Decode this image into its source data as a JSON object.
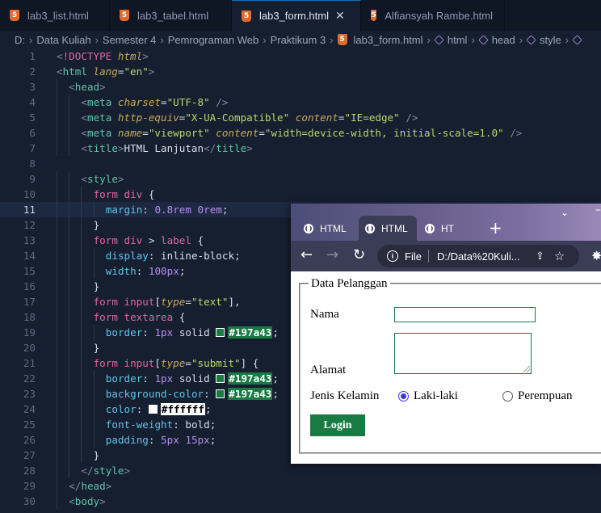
{
  "editor": {
    "tabs": [
      {
        "label": "lab3_list.html",
        "active": false
      },
      {
        "label": "lab3_tabel.html",
        "active": false
      },
      {
        "label": "lab3_form.html",
        "active": true
      },
      {
        "label": "Alfiansyah Rambe.html",
        "active": false
      }
    ],
    "breadcrumb": [
      "D:",
      "Data Kuliah",
      "Semester 4",
      "Pemrograman Web",
      "Praktikum 3",
      "lab3_form.html",
      "html",
      "head",
      "style"
    ],
    "current_line": 11,
    "lines": [
      {
        "n": "1",
        "indent": 0,
        "parts": [
          [
            "t-pu",
            "<"
          ],
          [
            "t-doc",
            "!DOCTYPE "
          ],
          [
            "t-att",
            "html"
          ],
          [
            "t-pu",
            ">"
          ]
        ]
      },
      {
        "n": "2",
        "indent": 0,
        "parts": [
          [
            "t-pu",
            "<"
          ],
          [
            "t-tag",
            "html "
          ],
          [
            "t-att",
            "lang"
          ],
          [
            "t-txt",
            "="
          ],
          [
            "t-str",
            "\"en\""
          ],
          [
            "t-pu",
            ">"
          ]
        ]
      },
      {
        "n": "3",
        "indent": 1,
        "parts": [
          [
            "t-pu",
            "<"
          ],
          [
            "t-tag",
            "head"
          ],
          [
            "t-pu",
            ">"
          ]
        ]
      },
      {
        "n": "4",
        "indent": 2,
        "parts": [
          [
            "t-pu",
            "<"
          ],
          [
            "t-tag",
            "meta "
          ],
          [
            "t-att",
            "charset"
          ],
          [
            "t-txt",
            "="
          ],
          [
            "t-str",
            "\"UTF-8\""
          ],
          [
            "t-pu",
            " />"
          ]
        ]
      },
      {
        "n": "5",
        "indent": 2,
        "parts": [
          [
            "t-pu",
            "<"
          ],
          [
            "t-tag",
            "meta "
          ],
          [
            "t-att",
            "http-equiv"
          ],
          [
            "t-txt",
            "="
          ],
          [
            "t-str",
            "\"X-UA-Compatible\" "
          ],
          [
            "t-att",
            "content"
          ],
          [
            "t-txt",
            "="
          ],
          [
            "t-str",
            "\"IE=edge\""
          ],
          [
            "t-pu",
            " />"
          ]
        ]
      },
      {
        "n": "6",
        "indent": 2,
        "parts": [
          [
            "t-pu",
            "<"
          ],
          [
            "t-tag",
            "meta "
          ],
          [
            "t-att",
            "name"
          ],
          [
            "t-txt",
            "="
          ],
          [
            "t-str",
            "\"viewport\" "
          ],
          [
            "t-att",
            "content"
          ],
          [
            "t-txt",
            "="
          ],
          [
            "t-str",
            "\"width=device-width, initial-scale=1.0\""
          ],
          [
            "t-pu",
            " />"
          ]
        ]
      },
      {
        "n": "7",
        "indent": 2,
        "parts": [
          [
            "t-pu",
            "<"
          ],
          [
            "t-tag",
            "title"
          ],
          [
            "t-pu",
            ">"
          ],
          [
            "t-txt",
            "HTML Lanjutan"
          ],
          [
            "t-pu",
            "</"
          ],
          [
            "t-tag",
            "title"
          ],
          [
            "t-pu",
            ">"
          ]
        ]
      },
      {
        "n": "8",
        "indent": 0,
        "parts": []
      },
      {
        "n": "9",
        "indent": 2,
        "parts": [
          [
            "t-pu",
            "<"
          ],
          [
            "t-tag",
            "style"
          ],
          [
            "t-pu",
            ">"
          ]
        ]
      },
      {
        "n": "10",
        "indent": 3,
        "parts": [
          [
            "t-sel",
            "form div "
          ],
          [
            "t-txt",
            "{"
          ]
        ]
      },
      {
        "n": "11",
        "indent": 4,
        "parts": [
          [
            "t-prop",
            "margin"
          ],
          [
            "t-txt",
            ": "
          ],
          [
            "t-num",
            "0.8rem 0rem"
          ],
          [
            "t-txt",
            ";"
          ]
        ]
      },
      {
        "n": "12",
        "indent": 3,
        "parts": [
          [
            "t-txt",
            "}"
          ]
        ]
      },
      {
        "n": "13",
        "indent": 3,
        "parts": [
          [
            "t-sel",
            "form div "
          ],
          [
            "t-txt",
            "> "
          ],
          [
            "t-sel",
            "label "
          ],
          [
            "t-txt",
            "{"
          ]
        ]
      },
      {
        "n": "14",
        "indent": 4,
        "parts": [
          [
            "t-prop",
            "display"
          ],
          [
            "t-txt",
            ": inline-block;"
          ]
        ]
      },
      {
        "n": "15",
        "indent": 4,
        "parts": [
          [
            "t-prop",
            "width"
          ],
          [
            "t-txt",
            ": "
          ],
          [
            "t-num",
            "100px"
          ],
          [
            "t-txt",
            ";"
          ]
        ]
      },
      {
        "n": "16",
        "indent": 3,
        "parts": [
          [
            "t-txt",
            "}"
          ]
        ]
      },
      {
        "n": "17",
        "indent": 3,
        "parts": [
          [
            "t-sel",
            "form input"
          ],
          [
            "t-txt",
            "["
          ],
          [
            "t-att",
            "type"
          ],
          [
            "t-txt",
            "="
          ],
          [
            "t-str",
            "\"text\""
          ],
          [
            "t-txt",
            "],"
          ]
        ]
      },
      {
        "n": "18",
        "indent": 3,
        "parts": [
          [
            "t-sel",
            "form textarea "
          ],
          [
            "t-txt",
            "{"
          ]
        ]
      },
      {
        "n": "19",
        "indent": 4,
        "parts": [
          [
            "t-prop",
            "border"
          ],
          [
            "t-txt",
            ": "
          ],
          [
            "t-num",
            "1px "
          ],
          [
            "t-txt",
            "solid "
          ],
          [
            "sw",
            "#197a43"
          ],
          [
            "chip",
            "#197a43"
          ],
          [
            "t-txt",
            ";"
          ]
        ]
      },
      {
        "n": "20",
        "indent": 3,
        "parts": [
          [
            "t-txt",
            "}"
          ]
        ]
      },
      {
        "n": "21",
        "indent": 3,
        "parts": [
          [
            "t-sel",
            "form input"
          ],
          [
            "t-txt",
            "["
          ],
          [
            "t-att",
            "type"
          ],
          [
            "t-txt",
            "="
          ],
          [
            "t-str",
            "\"submit\""
          ],
          [
            "t-txt",
            "] {"
          ]
        ]
      },
      {
        "n": "22",
        "indent": 4,
        "parts": [
          [
            "t-prop",
            "border"
          ],
          [
            "t-txt",
            ": "
          ],
          [
            "t-num",
            "1px "
          ],
          [
            "t-txt",
            "solid "
          ],
          [
            "sw",
            "#197a43"
          ],
          [
            "chip",
            "#197a43"
          ],
          [
            "t-txt",
            ";"
          ]
        ]
      },
      {
        "n": "23",
        "indent": 4,
        "parts": [
          [
            "t-prop",
            "background-color"
          ],
          [
            "t-txt",
            ": "
          ],
          [
            "sw",
            "#197a43"
          ],
          [
            "chip",
            "#197a43"
          ],
          [
            "t-txt",
            ";"
          ]
        ]
      },
      {
        "n": "24",
        "indent": 4,
        "parts": [
          [
            "t-prop",
            "color"
          ],
          [
            "t-txt",
            ": "
          ],
          [
            "sw",
            "#ffffff"
          ],
          [
            "chip",
            "#ffffff"
          ],
          [
            "t-txt",
            ";"
          ]
        ]
      },
      {
        "n": "25",
        "indent": 4,
        "parts": [
          [
            "t-prop",
            "font-weight"
          ],
          [
            "t-txt",
            ": bold;"
          ]
        ]
      },
      {
        "n": "26",
        "indent": 4,
        "parts": [
          [
            "t-prop",
            "padding"
          ],
          [
            "t-txt",
            ": "
          ],
          [
            "t-num",
            "5px 15px"
          ],
          [
            "t-txt",
            ";"
          ]
        ]
      },
      {
        "n": "27",
        "indent": 3,
        "parts": [
          [
            "t-txt",
            "}"
          ]
        ]
      },
      {
        "n": "28",
        "indent": 2,
        "parts": [
          [
            "t-pu",
            "</"
          ],
          [
            "t-tag",
            "style"
          ],
          [
            "t-pu",
            ">"
          ]
        ]
      },
      {
        "n": "29",
        "indent": 1,
        "parts": [
          [
            "t-pu",
            "</"
          ],
          [
            "t-tag",
            "head"
          ],
          [
            "t-pu",
            ">"
          ]
        ]
      },
      {
        "n": "30",
        "indent": 1,
        "parts": [
          [
            "t-pu",
            "<"
          ],
          [
            "t-tag",
            "body"
          ],
          [
            "t-pu",
            ">"
          ]
        ]
      }
    ]
  },
  "browser": {
    "tabs": [
      "HTML",
      "HTML",
      "HT"
    ],
    "new_tab": "+",
    "chevron": "⌄",
    "minimize": "–",
    "nav": {
      "back": "←",
      "forward": "→",
      "reload": "↻"
    },
    "omnibox": {
      "info": "i",
      "scheme": "File",
      "url": "D:/Data%20Kuli...",
      "share": "⇪",
      "star": "☆"
    },
    "extensions": "✸"
  },
  "form": {
    "legend": "Data Pelanggan",
    "nama_label": "Nama",
    "nama_value": "",
    "alamat_label": "Alamat",
    "alamat_value": "",
    "gender_label": "Jenis Kelamin",
    "gender_options": [
      "Laki-laki",
      "Perempuan"
    ],
    "gender_selected": "Laki-laki",
    "submit_label": "Login"
  },
  "colors": {
    "accent": "#197a43",
    "accent_text": "#ffffff",
    "editor_bg": "#161f30",
    "tab_active_border": "#1a6fc0"
  }
}
